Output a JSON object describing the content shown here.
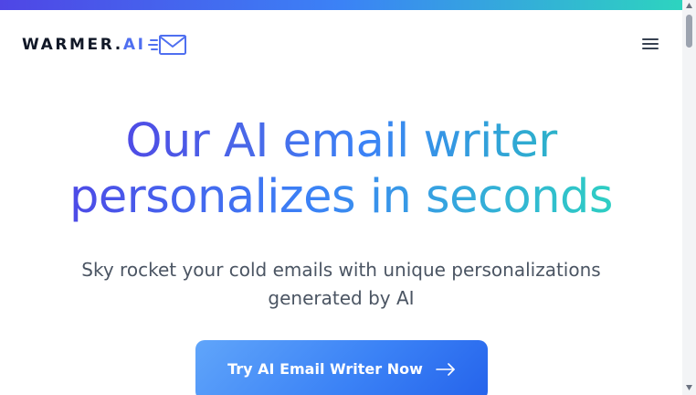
{
  "colors": {
    "gradient_start": "#4f46e5",
    "gradient_mid": "#3b82f6",
    "gradient_end": "#2dd4bf",
    "text_dark": "#111827",
    "text_muted": "#4b5563",
    "button_bg": "#3b82f6"
  },
  "header": {
    "logo": {
      "text_main": "WARMER.",
      "text_accent": "AI",
      "icon": "envelope-icon"
    },
    "menu_icon": "hamburger-menu-icon"
  },
  "hero": {
    "headline_line1": "Our AI email writer",
    "headline_line2": "personalizes in seconds",
    "subhead_line1": "Sky rocket your cold emails with unique personalizations",
    "subhead_line2": "generated by AI",
    "cta": {
      "label": "Try AI Email Writer Now",
      "icon": "arrow-right-icon"
    }
  }
}
